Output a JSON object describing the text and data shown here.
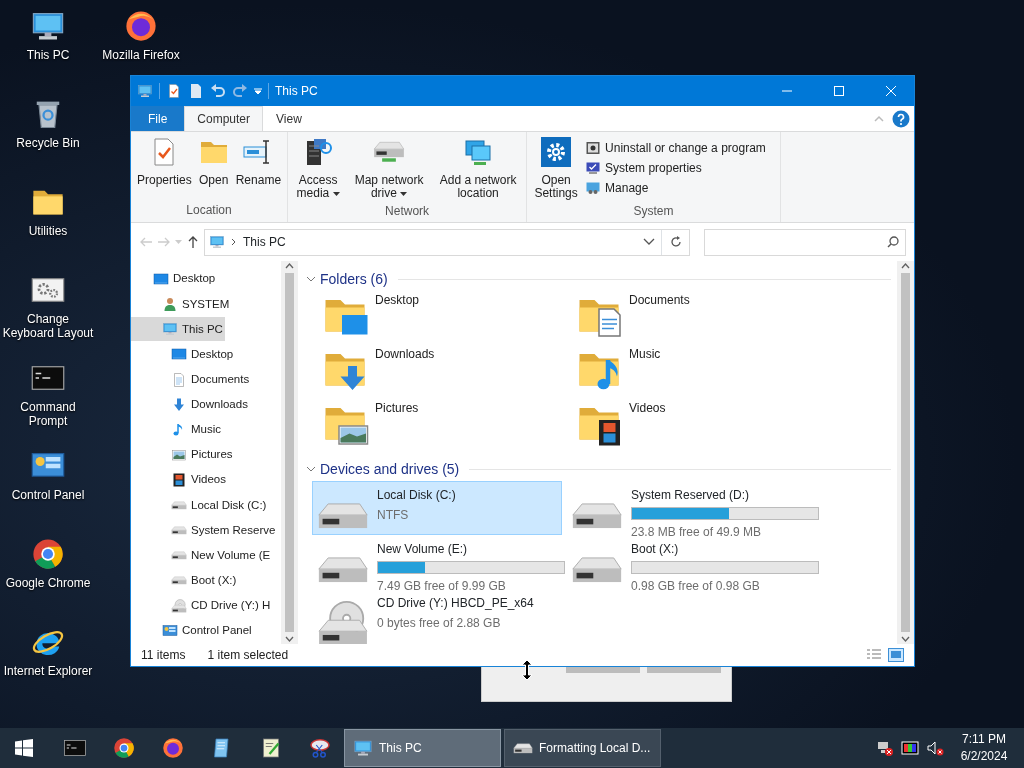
{
  "desktop_icons": [
    {
      "label": "This PC",
      "kind": "pc"
    },
    {
      "label": "Recycle Bin",
      "kind": "bin"
    },
    {
      "label": "Utilities",
      "kind": "folder"
    },
    {
      "label": "Change Keyboard Layout",
      "kind": "gearwin"
    },
    {
      "label": "Command Prompt",
      "kind": "cmd"
    },
    {
      "label": "Control Panel",
      "kind": "cp"
    },
    {
      "label": "Google Chrome",
      "kind": "chrome"
    },
    {
      "label": "Internet Explorer",
      "kind": "ie"
    },
    {
      "label": "Mozilla Firefox",
      "kind": "firefox"
    }
  ],
  "window": {
    "title": "This PC",
    "tabs": [
      {
        "label": "File",
        "kind": "file",
        "selected": false
      },
      {
        "label": "Computer",
        "kind": "tab",
        "selected": true
      },
      {
        "label": "View",
        "kind": "tab",
        "selected": false
      }
    ],
    "ribbon_groups": [
      {
        "label": "Location",
        "buttons": [
          {
            "label": "Properties",
            "kind": "props",
            "dropdown": false
          },
          {
            "label": "Open",
            "kind": "folder",
            "dropdown": false
          },
          {
            "label": "Rename",
            "kind": "rename",
            "dropdown": false
          }
        ]
      },
      {
        "label": "Network",
        "buttons": [
          {
            "label": "Access media",
            "kind": "media",
            "dropdown": true
          },
          {
            "label": "Map network drive",
            "kind": "mapdrive",
            "dropdown": true
          },
          {
            "label": "Add a network location",
            "kind": "netloc",
            "dropdown": false
          }
        ]
      },
      {
        "label": "System",
        "buttons": [
          {
            "label": "Open Settings",
            "kind": "settings",
            "dropdown": false
          }
        ],
        "small_buttons": [
          {
            "label": "Uninstall or change a program",
            "kind": "uninstall"
          },
          {
            "label": "System properties",
            "kind": "sysprops"
          },
          {
            "label": "Manage",
            "kind": "manage"
          }
        ]
      }
    ],
    "address": {
      "path": "This PC"
    },
    "nav_tree": [
      {
        "label": "Desktop",
        "kind": "desktop",
        "selected": false,
        "children": [
          {
            "label": "SYSTEM",
            "kind": "user",
            "selected": false
          },
          {
            "label": "This PC",
            "kind": "pc",
            "selected": true,
            "children": [
              {
                "label": "Desktop",
                "kind": "desktop",
                "selected": false
              },
              {
                "label": "Documents",
                "kind": "docs",
                "selected": false
              },
              {
                "label": "Downloads",
                "kind": "down",
                "selected": false
              },
              {
                "label": "Music",
                "kind": "music",
                "selected": false
              },
              {
                "label": "Pictures",
                "kind": "pics",
                "selected": false
              },
              {
                "label": "Videos",
                "kind": "video",
                "selected": false
              },
              {
                "label": "Local Disk (C:)",
                "kind": "drive",
                "selected": false
              },
              {
                "label": "System Reserve",
                "kind": "drive",
                "selected": false
              },
              {
                "label": "New Volume (E",
                "kind": "drive",
                "selected": false
              },
              {
                "label": "Boot (X:)",
                "kind": "drive",
                "selected": false
              },
              {
                "label": "CD Drive (Y:) H",
                "kind": "cd",
                "selected": false
              }
            ]
          },
          {
            "label": "Control Panel",
            "kind": "cp",
            "selected": false
          }
        ]
      }
    ],
    "folders_group": {
      "title": "Folders (6)",
      "expanded": true,
      "items": [
        {
          "label": "Desktop",
          "kind": "desktop"
        },
        {
          "label": "Documents",
          "kind": "docs"
        },
        {
          "label": "Downloads",
          "kind": "down"
        },
        {
          "label": "Music",
          "kind": "music"
        },
        {
          "label": "Pictures",
          "kind": "pics"
        },
        {
          "label": "Videos",
          "kind": "video"
        }
      ]
    },
    "drives_group": {
      "title": "Devices and drives (5)",
      "expanded": true,
      "items": [
        {
          "name": "Local Disk (C:)",
          "detail": "NTFS",
          "kind": "disk",
          "selected": true
        },
        {
          "name": "System Reserved (D:)",
          "detail": "23.8 MB free of 49.9 MB",
          "kind": "disk_bar",
          "level": 0.52,
          "selected": false
        },
        {
          "name": "New Volume (E:)",
          "detail": "7.49 GB free of 9.99 GB",
          "kind": "disk_bar",
          "level": 0.25,
          "selected": false
        },
        {
          "name": "Boot (X:)",
          "detail": "0.98 GB free of 0.98 GB",
          "kind": "disk_bar",
          "level": 0,
          "selected": false
        },
        {
          "name": "CD Drive (Y:) HBCD_PE_x64",
          "detail": "0 bytes free of 2.88 GB",
          "kind": "cd",
          "selected": false
        }
      ]
    },
    "status_bar": {
      "item_count": "11 items",
      "selection": "1 item selected"
    }
  },
  "taskbar": {
    "tasks": [
      {
        "label": "This PC",
        "kind": "pc",
        "selected": true
      },
      {
        "label": "Formatting Local D...",
        "kind": "drive",
        "selected": false
      }
    ],
    "time": "7:11 PM",
    "date": "6/2/2024"
  }
}
